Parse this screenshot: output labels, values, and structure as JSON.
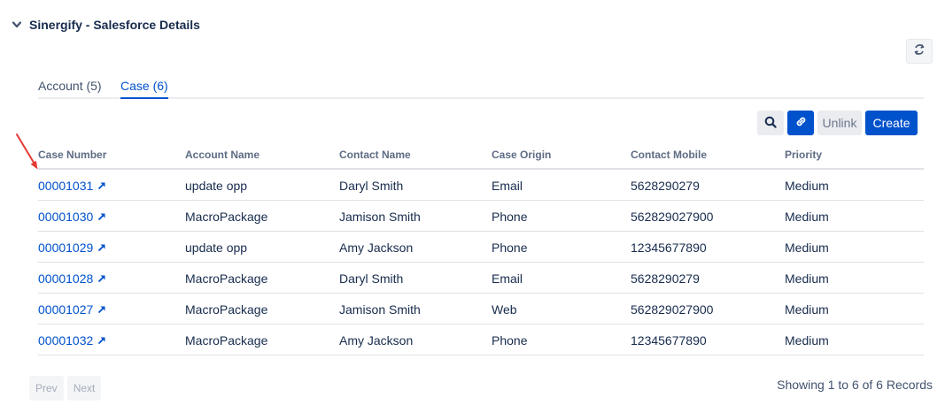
{
  "panel": {
    "title": "Sinergify - Salesforce Details"
  },
  "tabs": [
    {
      "label": "Account (5)"
    },
    {
      "label": "Case (6)"
    }
  ],
  "toolbar": {
    "unlink_label": "Unlink",
    "create_label": "Create"
  },
  "table": {
    "headers": [
      "Case Number",
      "Account Name",
      "Contact Name",
      "Case Origin",
      "Contact Mobile",
      "Priority"
    ],
    "rows": [
      [
        "00001031",
        "update opp",
        "Daryl Smith",
        "Email",
        "5628290279",
        "Medium"
      ],
      [
        "00001030",
        "MacroPackage",
        "Jamison Smith",
        "Phone",
        "562829027900",
        "Medium"
      ],
      [
        "00001029",
        "update opp",
        "Amy Jackson",
        "Phone",
        "12345677890",
        "Medium"
      ],
      [
        "00001028",
        "MacroPackage",
        "Daryl Smith",
        "Email",
        "5628290279",
        "Medium"
      ],
      [
        "00001027",
        "MacroPackage",
        "Jamison Smith",
        "Web",
        "562829027900",
        "Medium"
      ],
      [
        "00001032",
        "MacroPackage",
        "Amy Jackson",
        "Phone",
        "12345677890",
        "Medium"
      ]
    ]
  },
  "pagination": {
    "prev_label": "Prev",
    "next_label": "Next",
    "records_label": "Showing 1 to 6 of 6 Records"
  },
  "colors": {
    "accent": "#0052cc",
    "annotation": "#e53935"
  }
}
